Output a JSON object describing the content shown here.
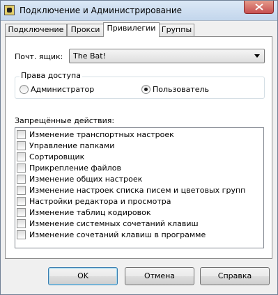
{
  "window": {
    "title": "Подключение и Администрирование",
    "icon": "thebat-icon"
  },
  "tabs": [
    {
      "label": "Подключение",
      "active": false
    },
    {
      "label": "Прокси",
      "active": false
    },
    {
      "label": "Привилегии",
      "active": true
    },
    {
      "label": "Группы",
      "active": false
    }
  ],
  "mailbox": {
    "label": "Почт. ящик:",
    "selected": "The Bat!"
  },
  "access_rights": {
    "title": "Права доступа",
    "options": [
      {
        "label": "Администратор",
        "checked": false
      },
      {
        "label": "Пользователь",
        "checked": true
      }
    ]
  },
  "forbidden": {
    "label": "Запрещённые действия:",
    "items": [
      {
        "label": "Изменение транспортных настроек",
        "checked": false
      },
      {
        "label": "Управление папками",
        "checked": false
      },
      {
        "label": "Сортировщик",
        "checked": false
      },
      {
        "label": "Прикрепление файлов",
        "checked": false
      },
      {
        "label": "Изменение общих настроек",
        "checked": false
      },
      {
        "label": "Изменение настроек списка писем и цветовых групп",
        "checked": false
      },
      {
        "label": "Настройки редактора и просмотра",
        "checked": false
      },
      {
        "label": "Изменение таблиц кодировок",
        "checked": false
      },
      {
        "label": "Изменение системных сочетаний клавиш",
        "checked": false
      },
      {
        "label": "Изменение сочетаний клавиш в программе",
        "checked": false
      }
    ]
  },
  "buttons": {
    "ok": "OK",
    "cancel": "Отмена",
    "help": "Справка"
  }
}
